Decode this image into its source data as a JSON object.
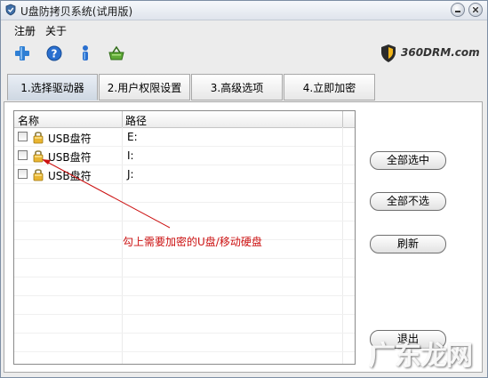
{
  "window": {
    "title": "U盘防拷贝系统(试用版)"
  },
  "menu": {
    "items": [
      "注册",
      "关于"
    ]
  },
  "toolbar": {
    "icons": [
      "plus-icon",
      "help-icon",
      "info-icon",
      "basket-icon"
    ]
  },
  "brand": {
    "text": "360DRM.com"
  },
  "tabs": [
    {
      "label": "1.选择驱动器",
      "active": true
    },
    {
      "label": "2.用户权限设置",
      "active": false
    },
    {
      "label": "3.高级选项",
      "active": false
    },
    {
      "label": "4.立即加密",
      "active": false
    }
  ],
  "drive_list": {
    "columns": [
      "名称",
      "路径"
    ],
    "rows": [
      {
        "name": "USB盘符",
        "path": "E:"
      },
      {
        "name": "USB盘符",
        "path": "I:"
      },
      {
        "name": "USB盘符",
        "path": "J:"
      }
    ]
  },
  "buttons": {
    "select_all": "全部选中",
    "deselect_all": "全部不选",
    "refresh": "刷新",
    "exit": "退出"
  },
  "annotation": {
    "text": "勾上需要加密的U盘/移动硬盘",
    "color": "#cc1111"
  },
  "watermark": {
    "text": "广东龙网"
  }
}
